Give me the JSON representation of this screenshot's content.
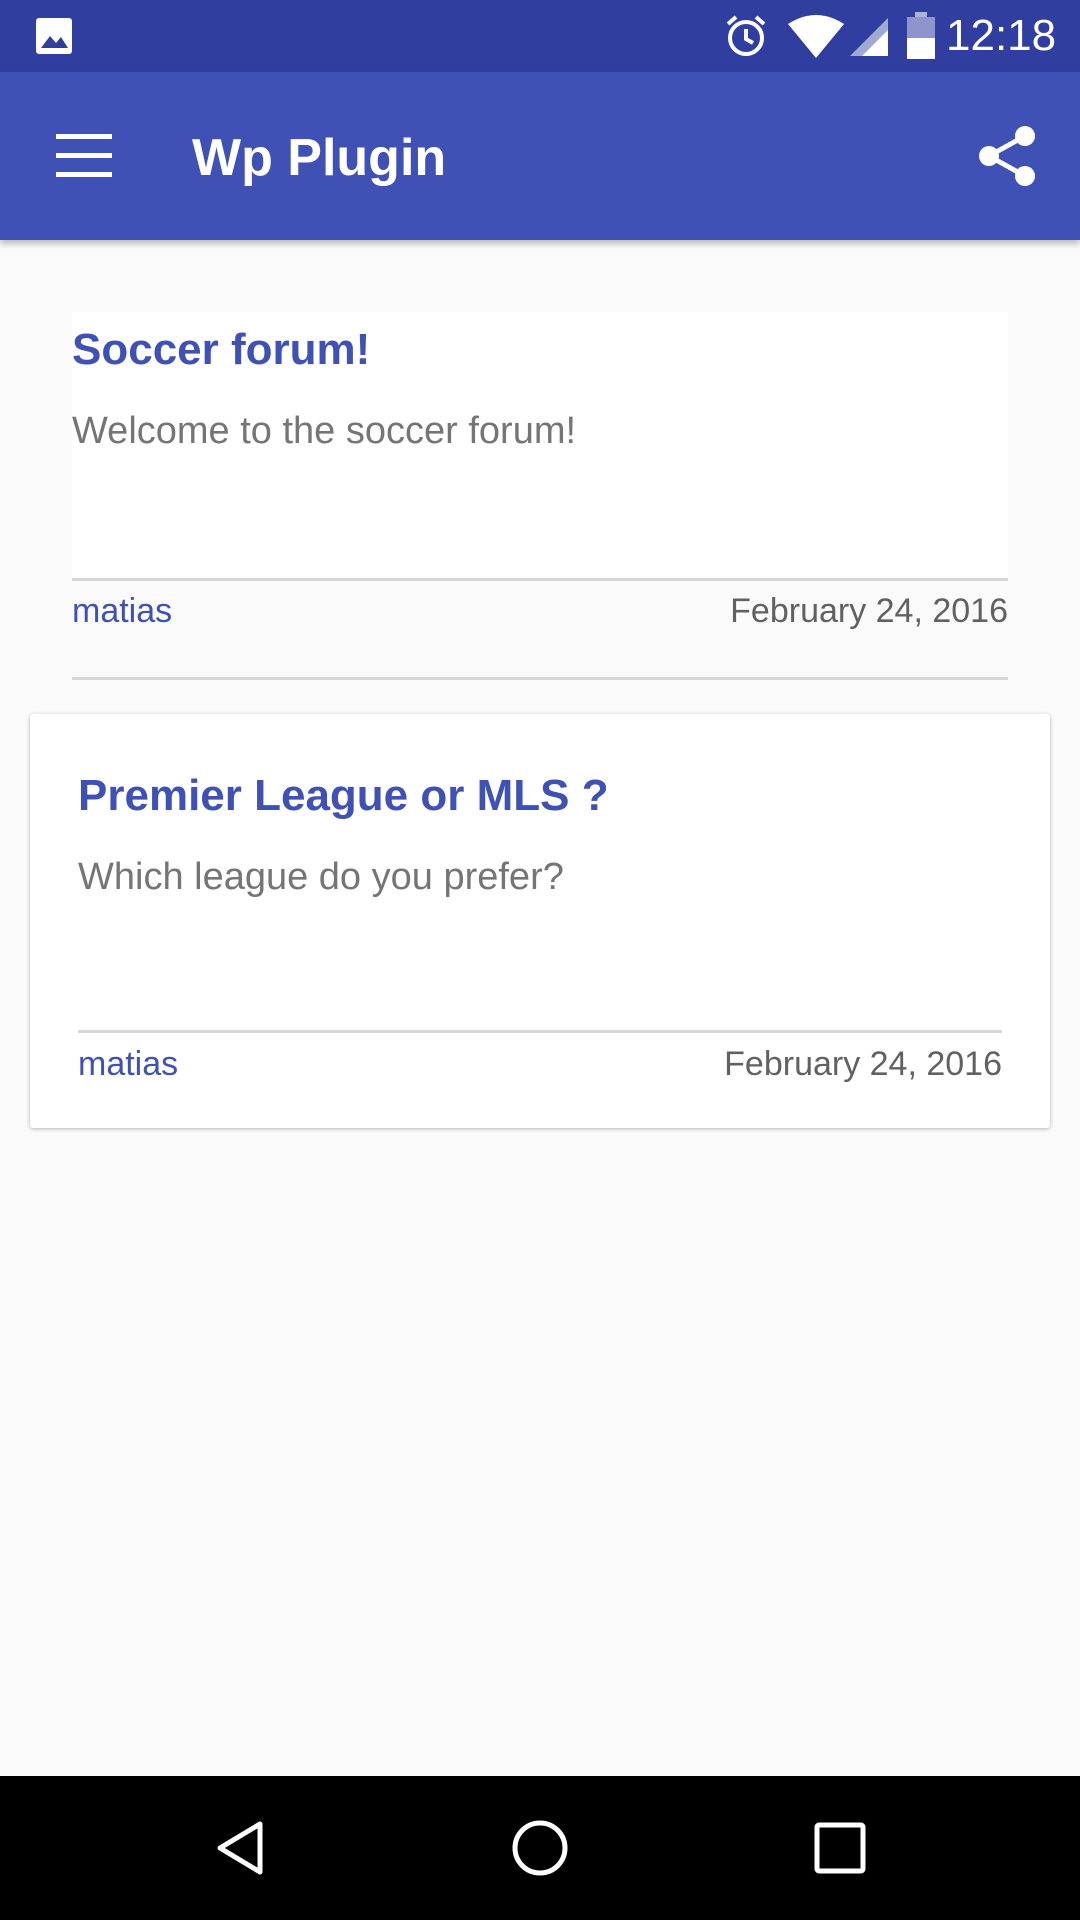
{
  "status_bar": {
    "time": "12:18",
    "icons": [
      "gallery-icon",
      "alarm-icon",
      "wifi-icon",
      "signal-icon",
      "battery-icon"
    ]
  },
  "app_bar": {
    "title": "Wp Plugin",
    "icons": [
      "menu-icon",
      "share-icon"
    ],
    "color": "#3f51b5"
  },
  "posts": [
    {
      "title": "Soccer forum!",
      "excerpt": "Welcome to the soccer forum!",
      "author": "matias",
      "date": "February 24, 2016"
    },
    {
      "title": "Premier League or MLS ?",
      "excerpt": "Which league do you prefer?",
      "author": "matias",
      "date": "February 24, 2016"
    }
  ],
  "nav_bar": {
    "icons": [
      "back-icon",
      "home-icon",
      "recents-icon"
    ]
  },
  "colors": {
    "primary": "#3f51b5",
    "primary_dark": "#303f9f",
    "background": "#fafafa"
  }
}
